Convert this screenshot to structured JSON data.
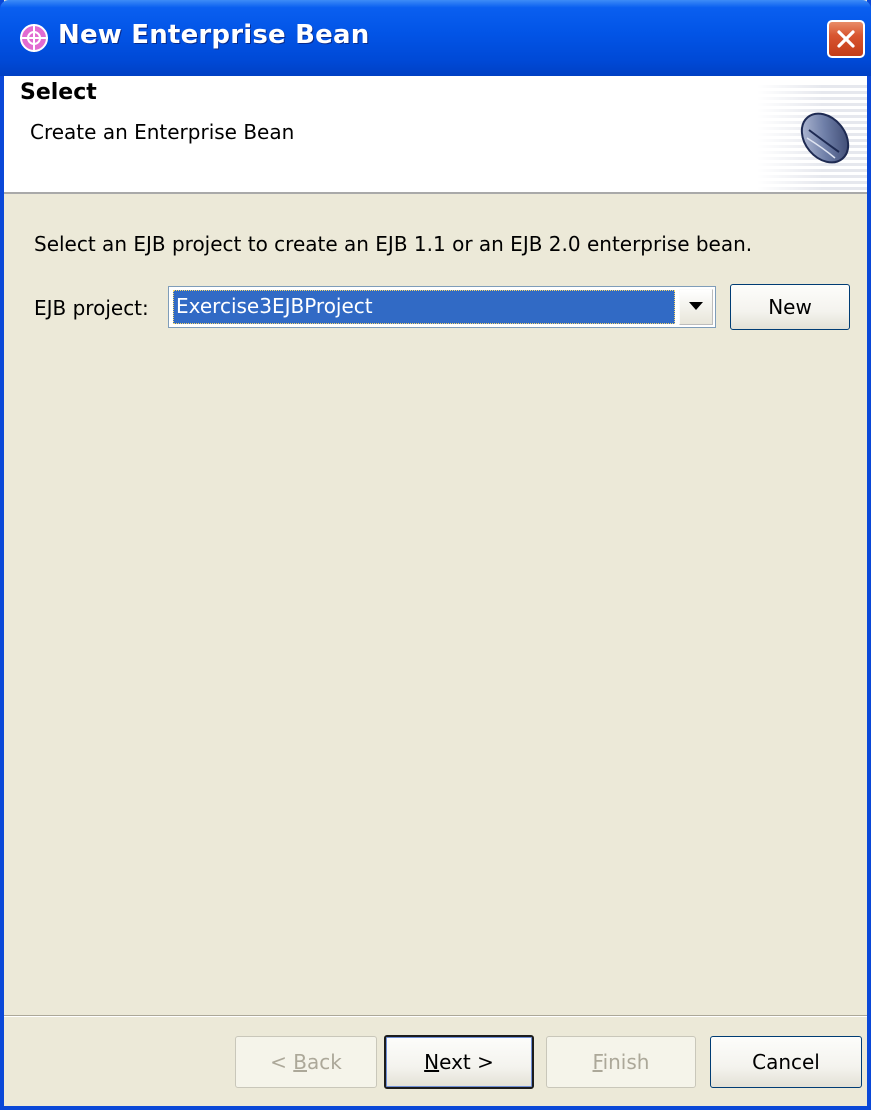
{
  "window": {
    "title": "New Enterprise Bean",
    "icon": "wizard-crosshair-icon"
  },
  "header": {
    "title": "Select",
    "description": "Create an Enterprise Bean",
    "icon": "enterprise-bean-icon"
  },
  "body": {
    "instruction": "Select an EJB project to create an EJB 1.1 or an EJB 2.0 enterprise bean.",
    "project_label": "EJB project:",
    "project_value": "Exercise3EJBProject",
    "new_button": "New"
  },
  "buttons": {
    "back": {
      "prefix": "< ",
      "mnemonic": "B",
      "rest": "ack",
      "enabled": false
    },
    "next": {
      "mnemonic": "N",
      "rest": "ext >",
      "enabled": true
    },
    "finish": {
      "mnemonic": "F",
      "rest": "inish",
      "enabled": false
    },
    "cancel": {
      "label": "Cancel",
      "enabled": true
    }
  },
  "colors": {
    "titlebar": "#0254e6",
    "dialog_bg": "#ece9d8",
    "selection": "#316ac5",
    "close_button": "#d85530"
  }
}
